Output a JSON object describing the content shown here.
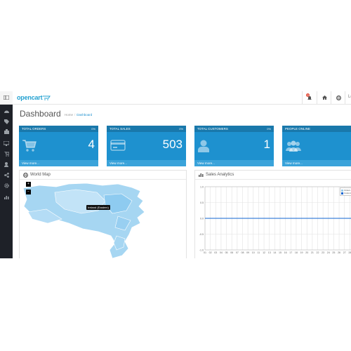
{
  "header": {
    "logo_text": "opencart",
    "notification_count": "3",
    "user_label": "Lo"
  },
  "page": {
    "title": "Dashboard",
    "breadcrumb": [
      "Home",
      "Dashboard"
    ]
  },
  "tiles": [
    {
      "heading": "TOTAL ORDERS",
      "badge": "0%",
      "value": "4",
      "footer": "View more...",
      "icon": "shopping-cart-icon"
    },
    {
      "heading": "TOTAL SALES",
      "badge": "0%",
      "value": "503",
      "footer": "View more...",
      "icon": "credit-card-icon"
    },
    {
      "heading": "TOTAL CUSTOMERS",
      "badge": "0%",
      "value": "1",
      "footer": "View more...",
      "icon": "user-icon"
    },
    {
      "heading": "PEOPLE ONLINE",
      "badge": "",
      "value": "",
      "footer": "View more...",
      "icon": "users-icon"
    }
  ],
  "map_panel": {
    "title": "World Map",
    "zoom_in": "+",
    "zoom_out": "−",
    "tooltip": "Ireland (Eastern)"
  },
  "chart_panel": {
    "title": "Sales Analytics"
  },
  "chart_data": {
    "type": "line",
    "title": "",
    "y_ticks": [
      "1.0",
      "0.5",
      "0.0",
      "-0.5",
      "-1.0"
    ],
    "ylim": [
      -1,
      1
    ],
    "categories": [
      "01",
      "02",
      "03",
      "04",
      "05",
      "06",
      "07",
      "08",
      "09",
      "10",
      "11",
      "12",
      "13",
      "14",
      "15",
      "16",
      "17",
      "18",
      "19",
      "20",
      "21",
      "22",
      "23",
      "24",
      "25",
      "26",
      "27",
      "28",
      "29"
    ],
    "series": [
      {
        "name": "Orders",
        "color": "#9bcbe9",
        "values": [
          0,
          0,
          0,
          0,
          0,
          0,
          0,
          0,
          0,
          0,
          0,
          0,
          0,
          0,
          0,
          0,
          0,
          0,
          0,
          0,
          0,
          0,
          0,
          0,
          0,
          0,
          0,
          0,
          0
        ]
      },
      {
        "name": "Customers",
        "color": "#1065d2",
        "values": [
          0,
          0,
          0,
          0,
          0,
          0,
          0,
          0,
          0,
          0,
          0,
          0,
          0,
          0,
          0,
          0,
          0,
          0,
          0,
          0,
          0,
          0,
          0,
          0,
          0,
          0,
          0,
          0,
          0
        ]
      }
    ],
    "grid": true,
    "legend": "top-right"
  },
  "colors": {
    "accent": "#1e91cf",
    "tile_header": "#1978ab",
    "tile_footer": "#3aa3da",
    "sidebar": "#1e2128",
    "map_fill": "#a6d6f2"
  }
}
